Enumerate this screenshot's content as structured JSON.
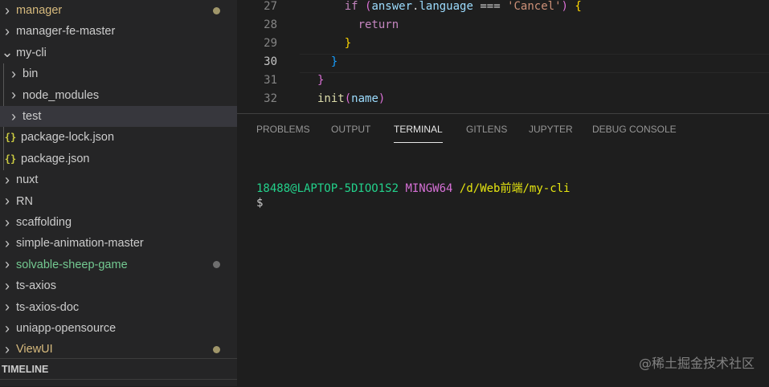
{
  "explorer": {
    "items": [
      {
        "label": "manager",
        "type": "folder",
        "expanded": false,
        "depth": 0,
        "color": "#d7ba7d",
        "badge": "#a0966a"
      },
      {
        "label": "manager-fe-master",
        "type": "folder",
        "expanded": false,
        "depth": 0
      },
      {
        "label": "my-cli",
        "type": "folder",
        "expanded": true,
        "depth": 0
      },
      {
        "label": "bin",
        "type": "folder",
        "expanded": false,
        "depth": 1
      },
      {
        "label": "node_modules",
        "type": "folder",
        "expanded": false,
        "depth": 1
      },
      {
        "label": "test",
        "type": "folder",
        "expanded": false,
        "depth": 1,
        "selected": true
      },
      {
        "label": "package-lock.json",
        "type": "json",
        "depth": 1
      },
      {
        "label": "package.json",
        "type": "json",
        "depth": 1
      },
      {
        "label": "nuxt",
        "type": "folder",
        "expanded": false,
        "depth": 0
      },
      {
        "label": "RN",
        "type": "folder",
        "expanded": false,
        "depth": 0
      },
      {
        "label": "scaffolding",
        "type": "folder",
        "expanded": false,
        "depth": 0
      },
      {
        "label": "simple-animation-master",
        "type": "folder",
        "expanded": false,
        "depth": 0
      },
      {
        "label": "solvable-sheep-game",
        "type": "folder",
        "expanded": false,
        "depth": 0,
        "color": "#73c991",
        "badge": "#6e6e6e"
      },
      {
        "label": "ts-axios",
        "type": "folder",
        "expanded": false,
        "depth": 0
      },
      {
        "label": "ts-axios-doc",
        "type": "folder",
        "expanded": false,
        "depth": 0
      },
      {
        "label": "uniapp-opensource",
        "type": "folder",
        "expanded": false,
        "depth": 0
      },
      {
        "label": "ViewUI",
        "type": "folder",
        "expanded": false,
        "depth": 0,
        "color": "#d7ba7d",
        "badge": "#a0966a"
      }
    ],
    "timeline_label": "TIMELINE"
  },
  "editor": {
    "lines": [
      {
        "num": "27",
        "indent": "    ",
        "tokens": [
          [
            "if ",
            "#c586c0"
          ],
          [
            "(",
            "#da70d6"
          ],
          [
            "answer",
            "#9cdcfe"
          ],
          [
            ".",
            "#d4d4d4"
          ],
          [
            "language",
            "#9cdcfe"
          ],
          [
            " === ",
            "#d4d4d4"
          ],
          [
            "'Cancel'",
            "#ce9178"
          ],
          [
            ")",
            "#da70d6"
          ],
          [
            " {",
            "#ffd700"
          ]
        ]
      },
      {
        "num": "28",
        "indent": "      ",
        "tokens": [
          [
            "return",
            "#c586c0"
          ]
        ]
      },
      {
        "num": "29",
        "indent": "    ",
        "tokens": [
          [
            "}",
            "#ffd700"
          ]
        ]
      },
      {
        "num": "30",
        "indent": "  ",
        "tokens": [
          [
            "}",
            "#179fff"
          ]
        ],
        "current": true
      },
      {
        "num": "31",
        "indent": "",
        "tokens": [
          [
            "}",
            "#da70d6"
          ]
        ]
      },
      {
        "num": "32",
        "indent": "",
        "tokens": [
          [
            "init",
            "#dcdcaa"
          ],
          [
            "(",
            "#da70d6"
          ],
          [
            "name",
            "#9cdcfe"
          ],
          [
            ")",
            "#da70d6"
          ]
        ]
      }
    ]
  },
  "panel": {
    "tabs": [
      "PROBLEMS",
      "OUTPUT",
      "TERMINAL",
      "GITLENS",
      "JUPYTER",
      "DEBUG CONSOLE"
    ],
    "active_tab": "TERMINAL"
  },
  "terminal": {
    "user": "18488@LAPTOP-5DIOO1S2",
    "system": "MINGW64",
    "path": "/d/Web前端/my-cli",
    "prompt": "$"
  },
  "watermark": "@稀土掘金技术社区"
}
